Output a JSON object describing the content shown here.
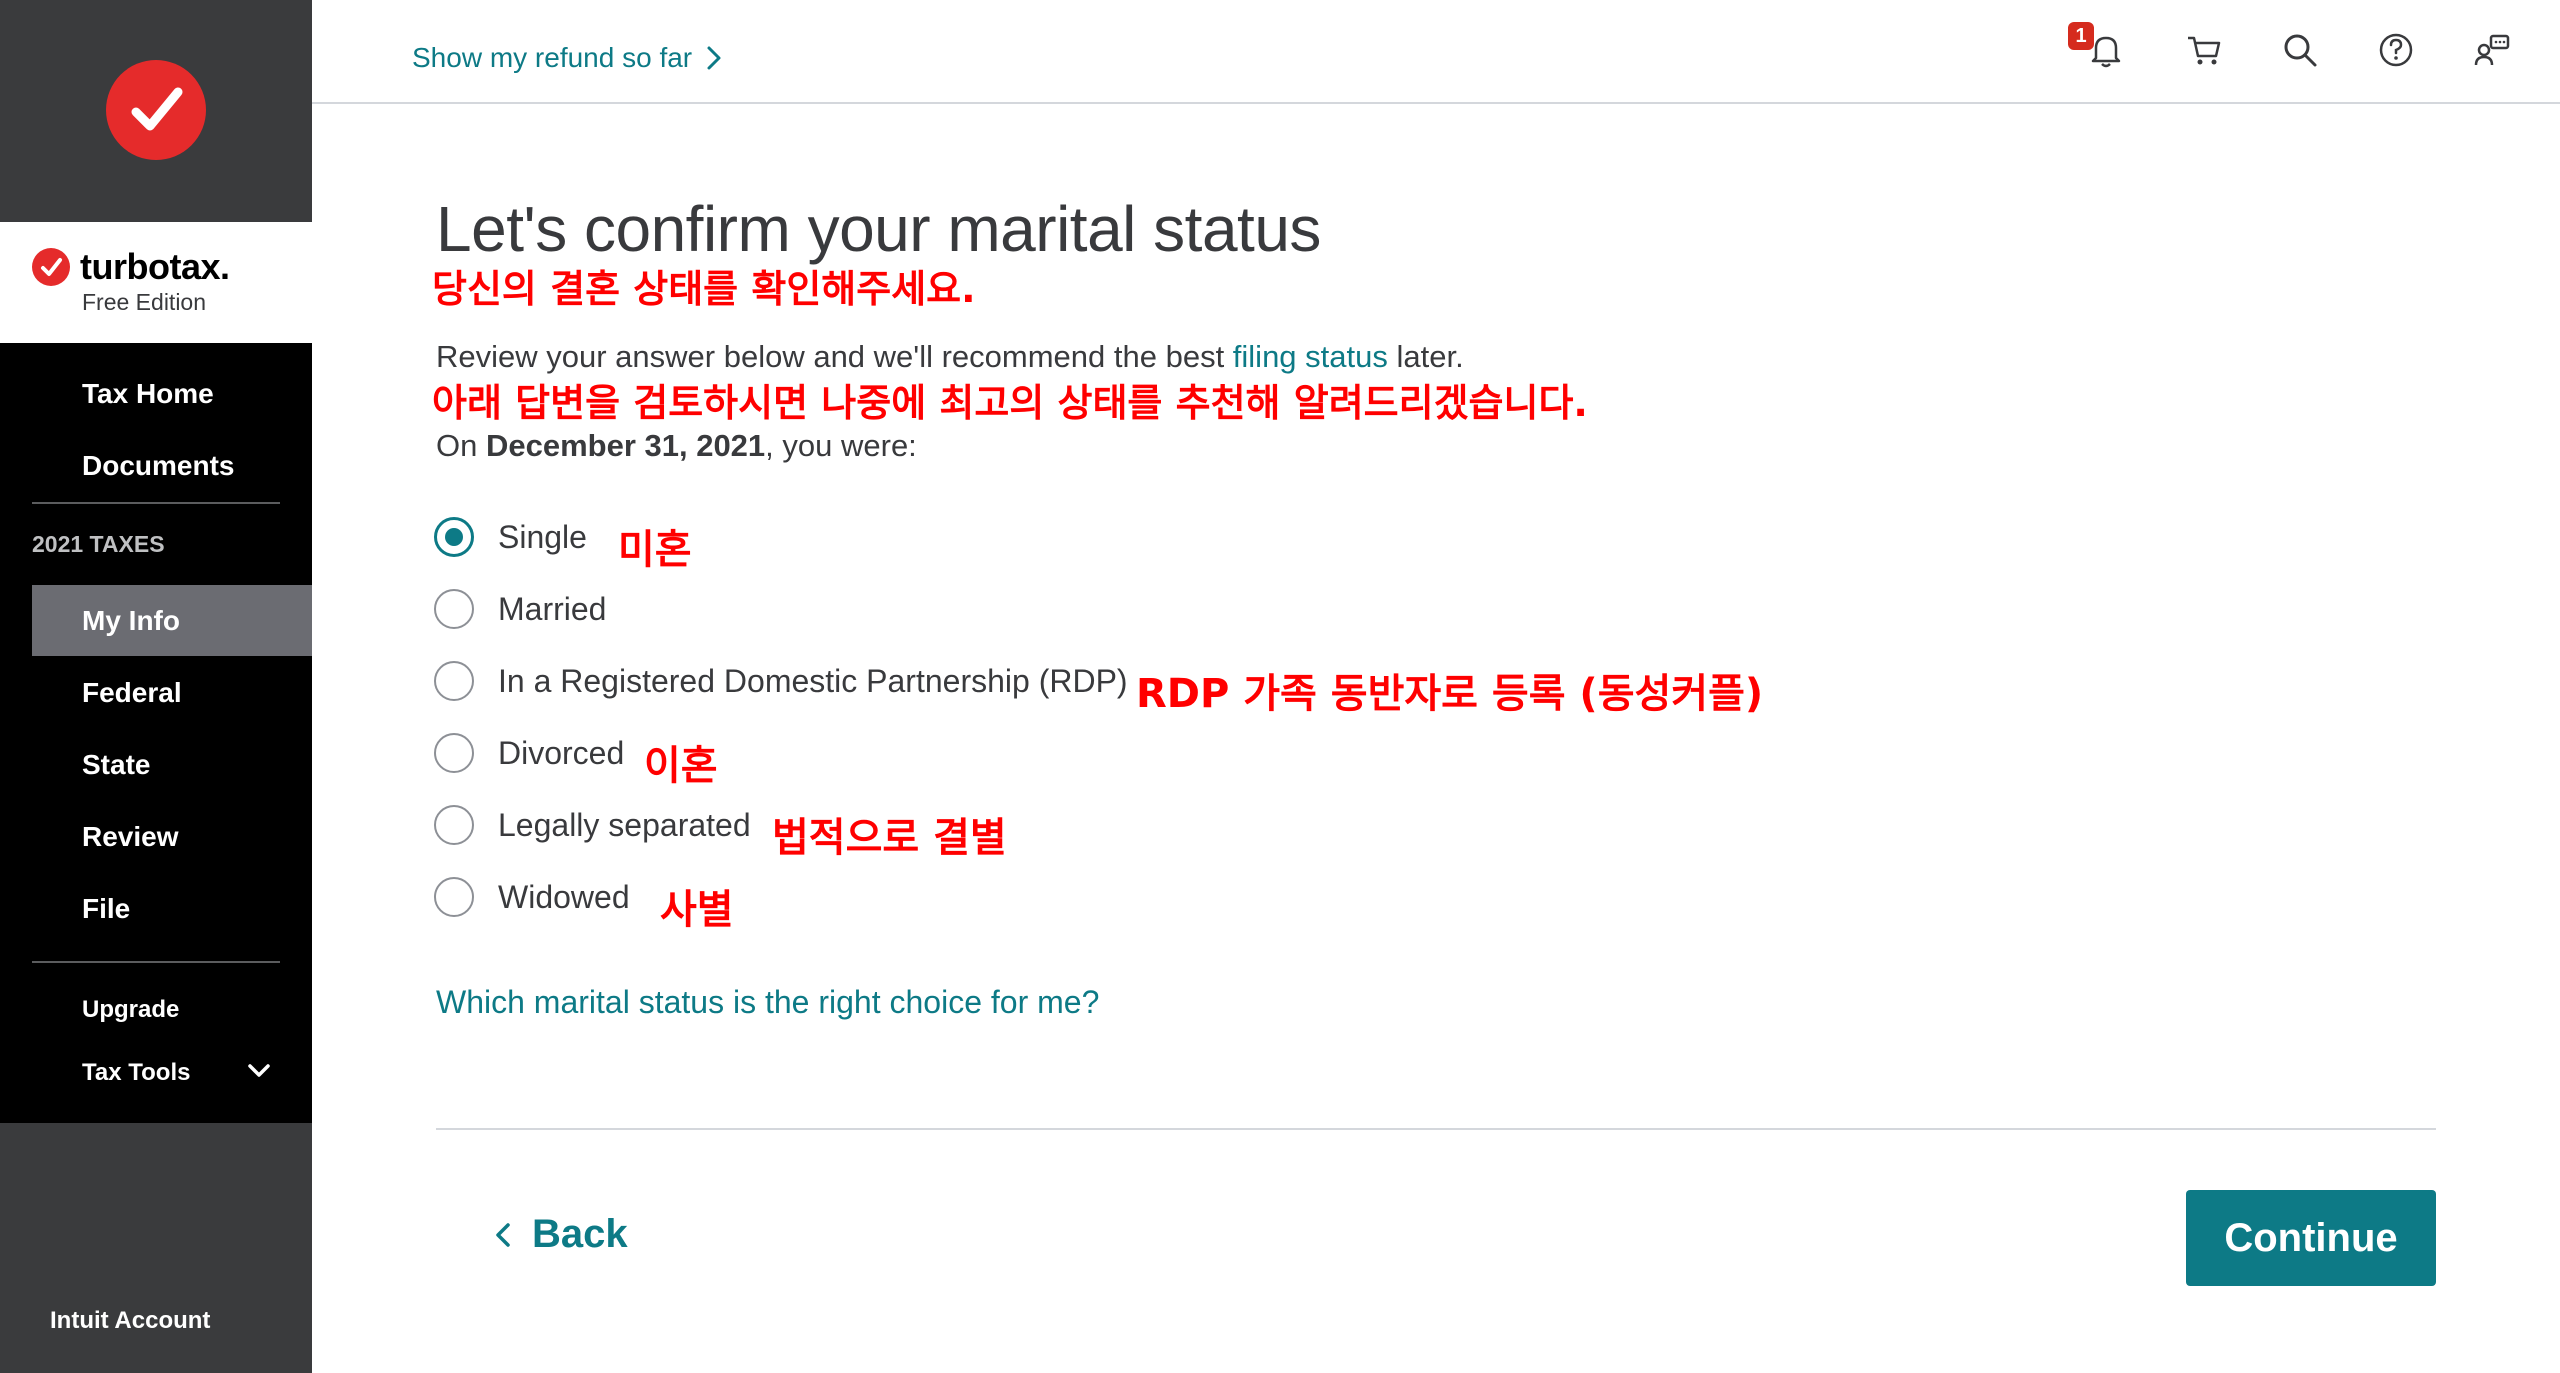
{
  "brand": {
    "name": "turbotax.",
    "edition": "Free Edition"
  },
  "sidebar": {
    "items": [
      {
        "label": "Tax Home"
      },
      {
        "label": "Documents"
      }
    ],
    "section_label": "2021 TAXES",
    "tax_items": [
      {
        "label": "My Info",
        "active": true
      },
      {
        "label": "Federal"
      },
      {
        "label": "State"
      },
      {
        "label": "Review"
      },
      {
        "label": "File"
      }
    ],
    "upgrade_label": "Upgrade",
    "tax_tools_label": "Tax Tools",
    "account_label": "Intuit Account"
  },
  "topbar": {
    "refund_link": "Show my refund so far",
    "notification_count": "1",
    "icons": [
      "bell-icon",
      "cart-icon",
      "search-icon",
      "help-icon",
      "chat-icon"
    ]
  },
  "main": {
    "title": "Let's confirm your marital status",
    "title_kr": "당신의 결혼 상태를 확인해주세요.",
    "desc_before": "Review your answer below and we'll recommend the best ",
    "desc_link": "filing status",
    "desc_after": " later.",
    "desc_kr": "아래 답변을 검토하시면 나중에 최고의 상태를 추천해 알려드리겠습니다.",
    "date_prefix": "On ",
    "date": "December 31, 2021",
    "date_suffix": ", you were:",
    "options": [
      {
        "label": "Single",
        "note": "미혼",
        "selected": true
      },
      {
        "label": "Married",
        "note": "",
        "selected": false
      },
      {
        "label": "In a Registered Domestic Partnership (RDP)",
        "note": "RDP 가족 동반자로 등록 (동성커플)",
        "selected": false
      },
      {
        "label": "Divorced",
        "note": "이혼",
        "selected": false
      },
      {
        "label": "Legally separated",
        "note": "법적으로 결별",
        "selected": false
      },
      {
        "label": "Widowed",
        "note": "사별",
        "selected": false
      }
    ],
    "help_link": "Which marital status is the right choice for me?",
    "back_label": "Back",
    "continue_label": "Continue"
  },
  "colors": {
    "accent": "#0d7a86",
    "brand_red": "#e52b2b",
    "annotation_red": "#ff0000"
  }
}
